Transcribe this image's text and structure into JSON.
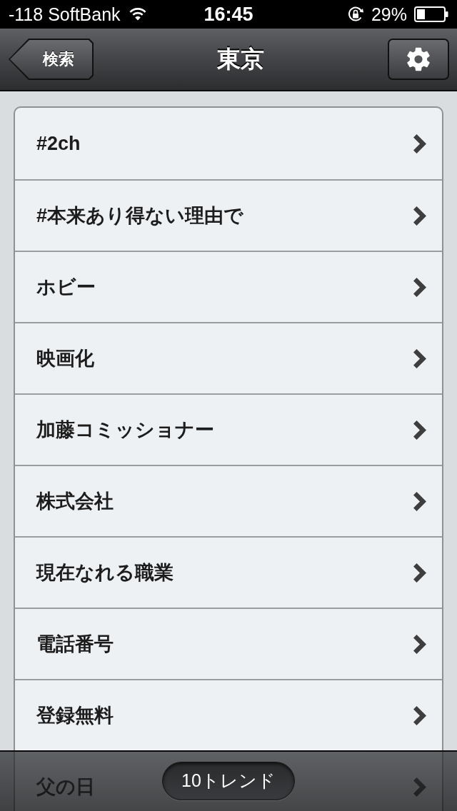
{
  "status_bar": {
    "carrier": "-118 SoftBank",
    "time": "16:45",
    "battery": "29%"
  },
  "nav_bar": {
    "back_button": "検索",
    "title": "東京"
  },
  "trends": [
    {
      "label": "#2ch"
    },
    {
      "label": "#本来あり得ない理由で"
    },
    {
      "label": "ホビー"
    },
    {
      "label": "映画化"
    },
    {
      "label": "加藤コミッショナー"
    },
    {
      "label": "株式会社"
    },
    {
      "label": "現在なれる職業"
    },
    {
      "label": "電話番号"
    },
    {
      "label": "登録無料"
    },
    {
      "label": "父の日"
    }
  ],
  "toolbar": {
    "button": "10トレンド"
  }
}
